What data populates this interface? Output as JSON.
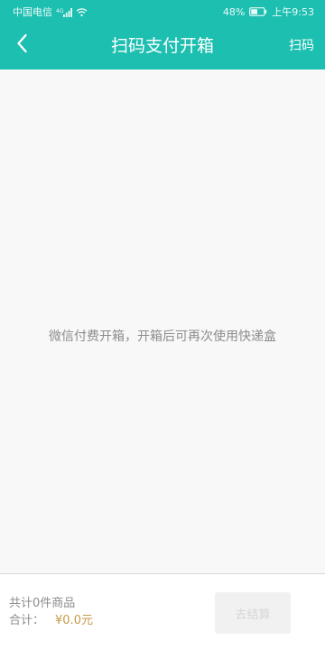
{
  "status_bar": {
    "carrier": "中国电信",
    "battery": "48%",
    "time": "上午9:53",
    "icons": [
      "signal-icon",
      "wifi-icon",
      "battery-icon"
    ]
  },
  "header": {
    "back_icon": "chevron-left-icon",
    "title": "扫码支付开箱",
    "scan_label": "扫码",
    "background_color": "#1DBFB0"
  },
  "main": {
    "message": "微信付费开箱，开箱后可再次使用快递盒"
  },
  "footer": {
    "count_text": "共计0件商品",
    "total_label": "合计：",
    "total_amount": "¥0.0元",
    "checkout_label": "去结算",
    "checkout_enabled": false,
    "amount_color": "#C59A4A"
  }
}
